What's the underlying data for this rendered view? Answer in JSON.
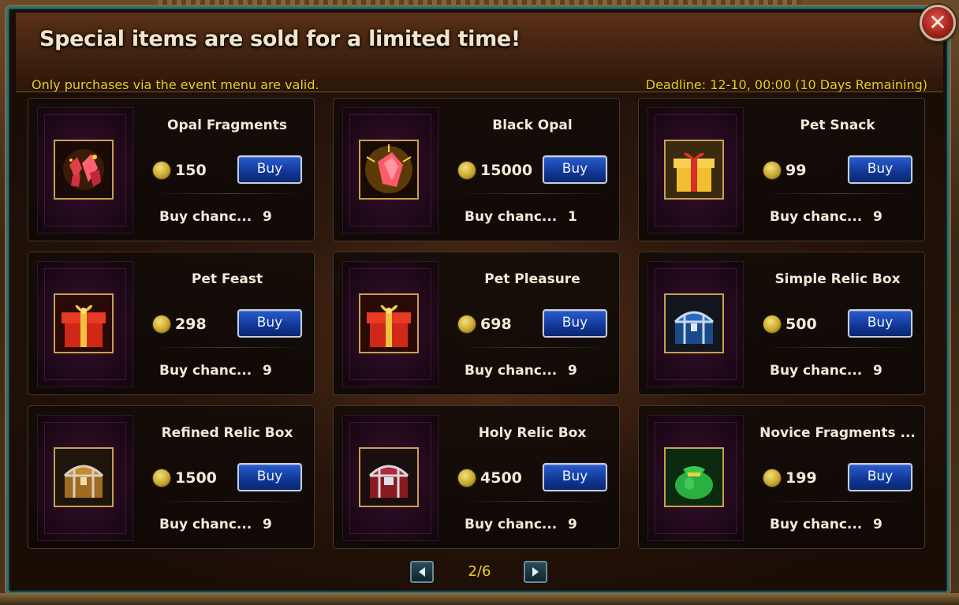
{
  "header": {
    "title": "Special items are sold for a limited time!",
    "subtitle": "Only purchases via the event menu are valid.",
    "deadline": "Deadline: 12-10, 00:00 (10 Days Remaining)"
  },
  "close_symbol": "✕",
  "labels": {
    "buy": "Buy",
    "chance": "Buy chanc..."
  },
  "items": [
    {
      "name": "Opal Fragments",
      "price": "150",
      "chance": "9",
      "icon": "opal-fragments-icon"
    },
    {
      "name": "Black Opal",
      "price": "15000",
      "chance": "1",
      "icon": "black-opal-icon"
    },
    {
      "name": "Pet Snack",
      "price": "99",
      "chance": "9",
      "icon": "gift-box-icon"
    },
    {
      "name": "Pet Feast",
      "price": "298",
      "chance": "9",
      "icon": "red-gift-box-icon"
    },
    {
      "name": "Pet Pleasure",
      "price": "698",
      "chance": "9",
      "icon": "red-gift-box-icon"
    },
    {
      "name": "Simple Relic Box",
      "price": "500",
      "chance": "9",
      "icon": "blue-chest-icon"
    },
    {
      "name": "Refined Relic Box",
      "price": "1500",
      "chance": "9",
      "icon": "gold-chest-icon"
    },
    {
      "name": "Holy Relic Box",
      "price": "4500",
      "chance": "9",
      "icon": "red-chest-icon"
    },
    {
      "name": "Novice Fragments ...",
      "price": "199",
      "chance": "9",
      "icon": "green-bag-icon"
    }
  ],
  "pagination": {
    "page": "2/6"
  },
  "colors": {
    "accent_yellow": "#f0d020",
    "buy_blue": "#1a4ab8"
  }
}
